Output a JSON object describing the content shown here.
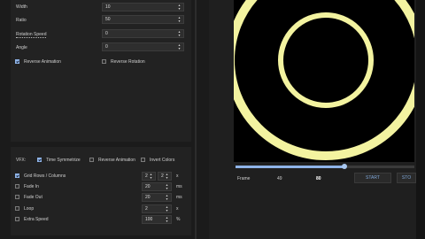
{
  "params": {
    "width": {
      "label": "Width",
      "value": "10"
    },
    "ratio": {
      "label": "Ratio",
      "value": "50"
    },
    "rotation_speed": {
      "label": "Rotation Speed",
      "value": "0"
    },
    "angle": {
      "label": "Angle",
      "value": "0"
    },
    "reverse_animation": {
      "label": "Reverse Animation",
      "checked": true
    },
    "reverse_rotation": {
      "label": "Reverse Rotation",
      "checked": false
    }
  },
  "vfx": {
    "label": "VFX:",
    "time_symmetrize": {
      "label": "Time Symmetrize",
      "checked": true
    },
    "reverse_animation": {
      "label": "Reverse Animation",
      "checked": false
    },
    "invert_colors": {
      "label": "Invert Colors",
      "checked": false
    },
    "grid": {
      "label": "Grid Rows / Columns",
      "checked": true,
      "rows": "2",
      "cols": "2",
      "unit": "x"
    },
    "fade_in": {
      "label": "Fade In",
      "checked": false,
      "value": "20",
      "unit": "ms"
    },
    "fade_out": {
      "label": "Fade Out",
      "checked": false,
      "value": "20",
      "unit": "ms"
    },
    "loop": {
      "label": "Loop",
      "checked": false,
      "value": "2",
      "unit": "x"
    },
    "extra_speed": {
      "label": "Extra Speed",
      "checked": false,
      "value": "100",
      "unit": "%"
    }
  },
  "player": {
    "frame_label": "Frame",
    "current_frame": "49",
    "total_frames": "80",
    "progress": 0.61,
    "start_label": "START",
    "stop_label": "STO"
  },
  "colors": {
    "ring": "#f3f3a0",
    "accent": "#8fb4e8"
  }
}
